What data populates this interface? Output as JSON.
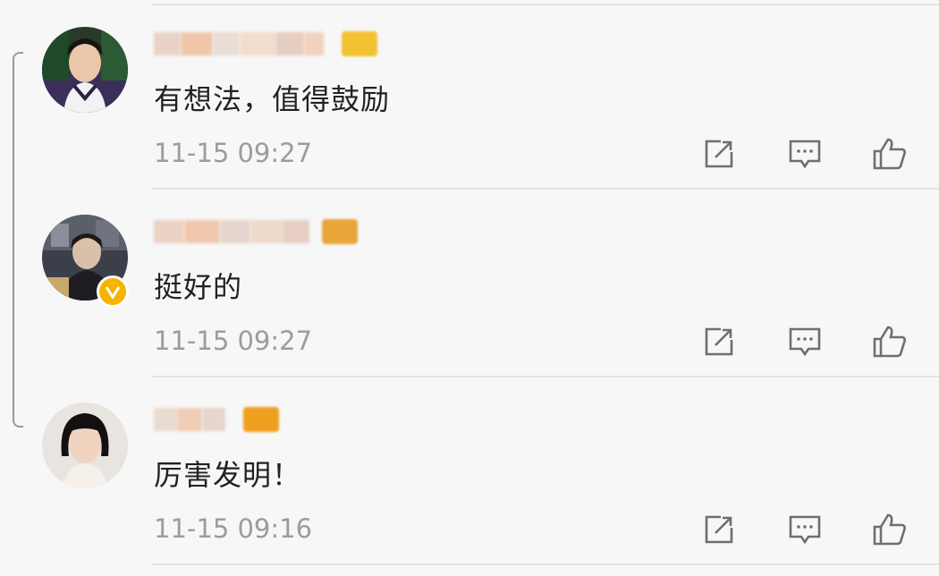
{
  "comments": [
    {
      "text": "有想法，值得鼓励",
      "time": "11-15 09:27",
      "verified": false,
      "badge_color": "#f2c232"
    },
    {
      "text": "挺好的",
      "time": "11-15 09:27",
      "verified": true,
      "badge_color": "#e8a53a"
    },
    {
      "text": "厉害发明！",
      "time": "11-15 09:16",
      "verified": false,
      "badge_color": "#f0a020"
    }
  ],
  "icons": {
    "share": "share-icon",
    "reply": "comment-icon",
    "like": "like-icon"
  },
  "colors": {
    "verified_badge": "#f5b400",
    "timestamp": "#9c9c9c",
    "text": "#222222"
  }
}
